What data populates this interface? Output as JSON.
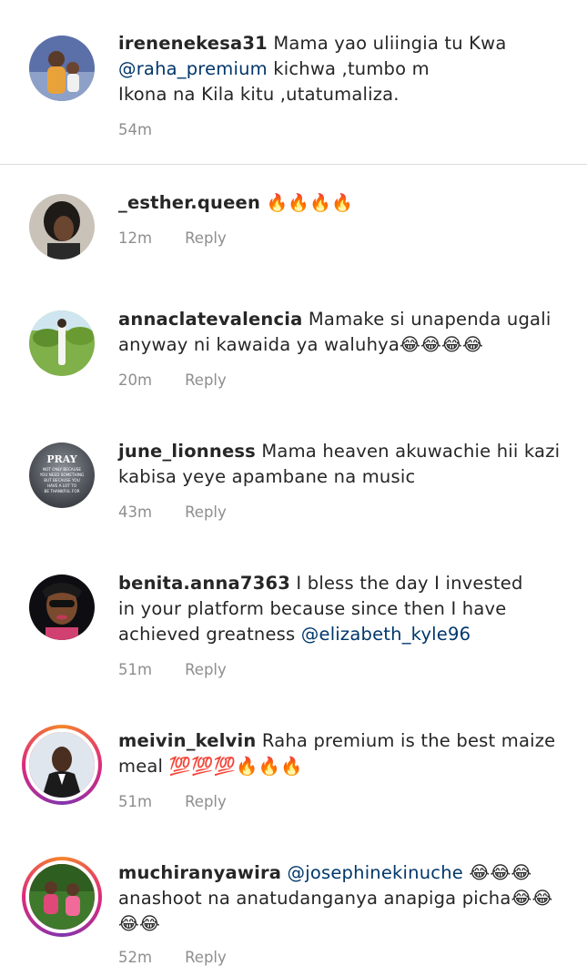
{
  "comments": [
    {
      "username": "irenenekesa31",
      "text_parts": [
        {
          "t": "Mama yao uliingia tu Kwa\n"
        },
        {
          "m": "@raha_premium"
        },
        {
          "t": " kichwa ,tumbo m\nIkona na Kila kitu ,utatumaliza."
        }
      ],
      "time": "54m",
      "reply": ""
    },
    {
      "username": "_esther.queen",
      "text_parts": [
        {
          "t": "🔥🔥🔥🔥"
        }
      ],
      "time": "12m",
      "reply": "Reply"
    },
    {
      "username": "annaclatevalencia",
      "text_parts": [
        {
          "t": "Mamake si unapenda ugali\nanyway ni kawaida ya waluhya😂😂😂😂"
        }
      ],
      "time": "20m",
      "reply": "Reply"
    },
    {
      "username": "june_lionness",
      "text_parts": [
        {
          "t": "Mama heaven akuwachie hii  kazi\nkabisa yeye apambane na music"
        }
      ],
      "time": "43m",
      "reply": "Reply",
      "avatar_text": [
        "PRAY",
        "NOT ONLY BECAUSE",
        "YOU NEED SOMETHING",
        "BUT BECAUSE YOU",
        "HAVE A LOT TO",
        "BE THANKFUL FOR"
      ]
    },
    {
      "username": "benita.anna7363",
      "text_parts": [
        {
          "t": "I bless the day I invested\nin your platform because since then I have\nachieved greatness "
        },
        {
          "m": "@elizabeth_kyle96"
        }
      ],
      "time": "51m",
      "reply": "Reply"
    },
    {
      "username": "meivin_kelvin",
      "text_parts": [
        {
          "t": "Raha premium is the best maize\nmeal 💯💯💯🔥🔥🔥"
        }
      ],
      "time": "51m",
      "reply": "Reply"
    },
    {
      "username": "muchiranyawira",
      "text_parts": [
        {
          "m": "@josephinekinuche"
        },
        {
          "t": " 😂😂😂\nanashoot na anatudanganya anapiga picha😂😂\n😂😂"
        }
      ],
      "time": "52m",
      "reply": "Reply"
    }
  ],
  "colors": {
    "mention": "#00376b",
    "meta": "#8e8e8e",
    "divider": "#dbdbdb"
  }
}
